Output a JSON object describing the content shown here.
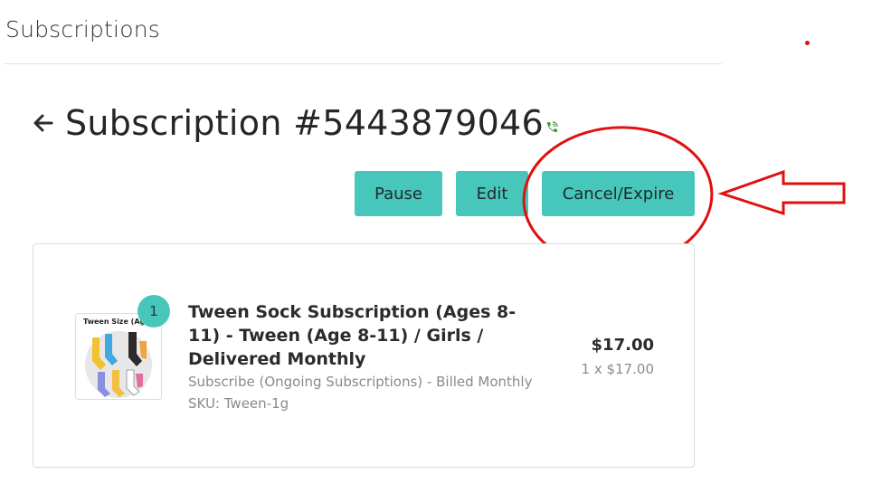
{
  "header": {
    "title": "Subscriptions"
  },
  "subscription": {
    "title": "Subscription #5443879046",
    "back_icon": "arrow-left-icon",
    "phone_icon": "phone-icon"
  },
  "actions": {
    "pause_label": "Pause",
    "edit_label": "Edit",
    "cancel_label": "Cancel/Expire"
  },
  "line_item": {
    "quantity": "1",
    "thumbnail_text": "Tween Size (Ages",
    "name": "Tween Sock Subscription (Ages 8-11) - Tween (Age 8-11) / Girls / Delivered Monthly",
    "plan": "Subscribe (Ongoing Subscriptions) - Billed Monthly",
    "sku": "SKU: Tween-1g",
    "price": "$17.00",
    "unit_price": "1 x $17.00"
  },
  "colors": {
    "accent": "#47c6bb",
    "annotation": "#e01010"
  }
}
